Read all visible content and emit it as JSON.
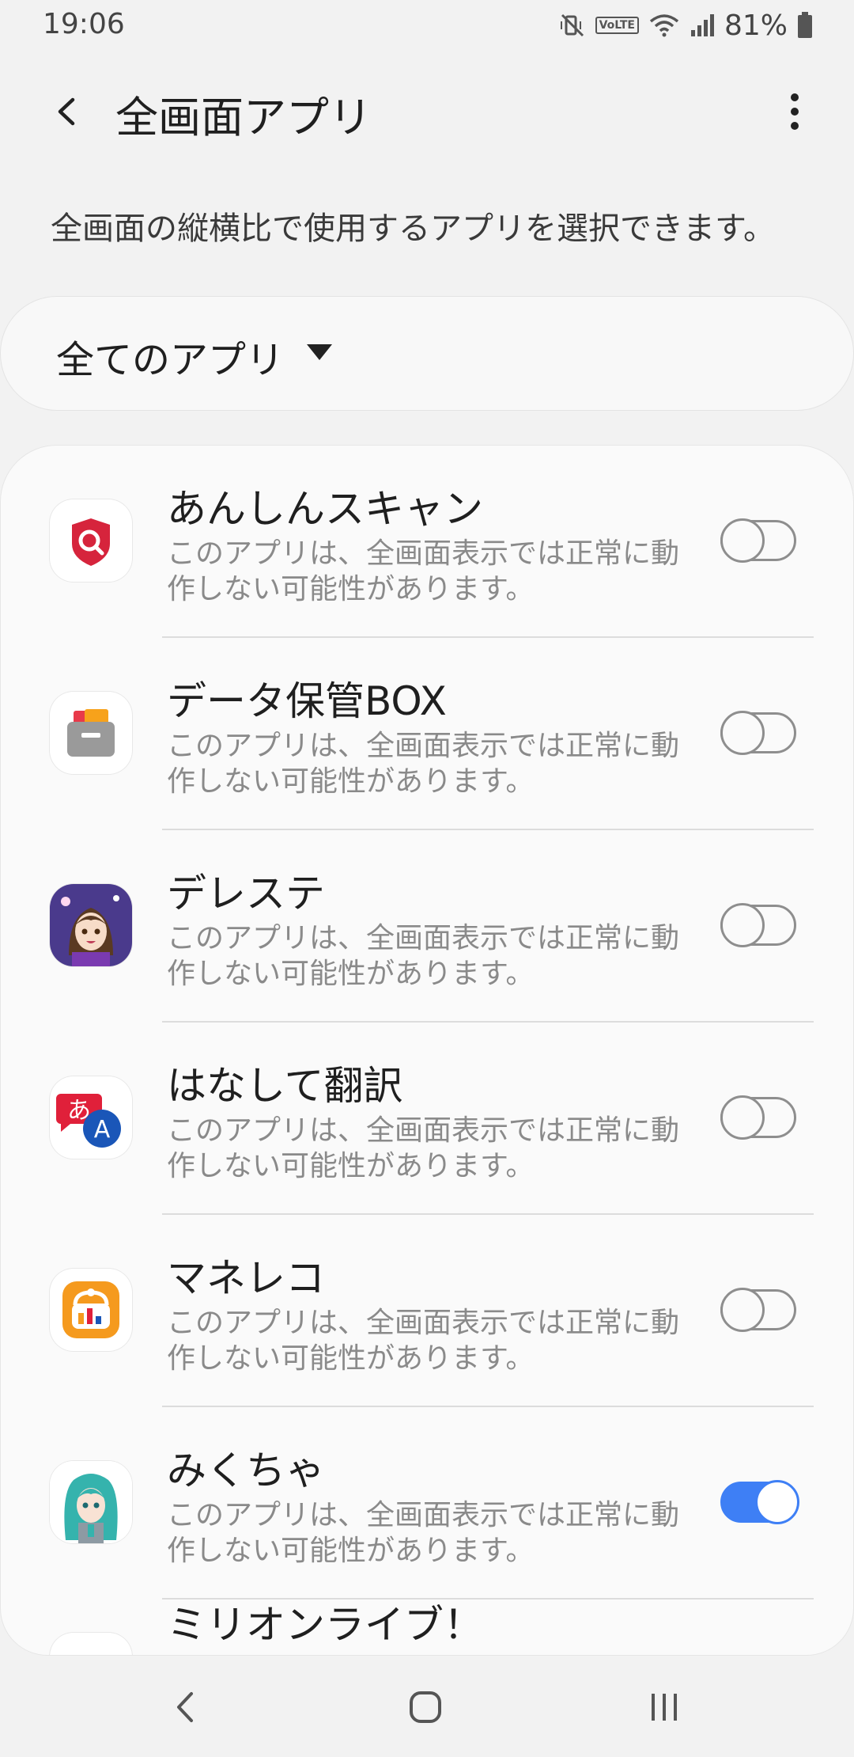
{
  "status": {
    "time": "19:06",
    "volte": "VoLTE",
    "battery": "81%"
  },
  "header": {
    "title": "全画面アプリ"
  },
  "description": "全画面の縦横比で使用するアプリを選択できます。",
  "filter": {
    "label": "全てのアプリ"
  },
  "apps": [
    {
      "name": "あんしんスキャン",
      "desc": "このアプリは、全画面表示では正常に動作しない可能性があります。",
      "enabled": false
    },
    {
      "name": "データ保管BOX",
      "desc": "このアプリは、全画面表示では正常に動作しない可能性があります。",
      "enabled": false
    },
    {
      "name": "デレステ",
      "desc": "このアプリは、全画面表示では正常に動作しない可能性があります。",
      "enabled": false
    },
    {
      "name": "はなして翻訳",
      "desc": "このアプリは、全画面表示では正常に動作しない可能性があります。",
      "enabled": false
    },
    {
      "name": "マネレコ",
      "desc": "このアプリは、全画面表示では正常に動作しない可能性があります。",
      "enabled": false
    },
    {
      "name": "みくちゃ",
      "desc": "このアプリは、全画面表示では正常に動作しない可能性があります。",
      "enabled": true
    }
  ],
  "partial_app": {
    "name": "ミリオンライブ！"
  },
  "icons": {
    "app_icons": [
      "shield-search-icon",
      "folder-box-icon",
      "character-avatar-icon",
      "translate-icon",
      "wallet-chart-icon",
      "character-avatar-icon"
    ]
  },
  "colors": {
    "toggle_on": "#3e7ff5",
    "toggle_off": "#8e8e8e"
  }
}
